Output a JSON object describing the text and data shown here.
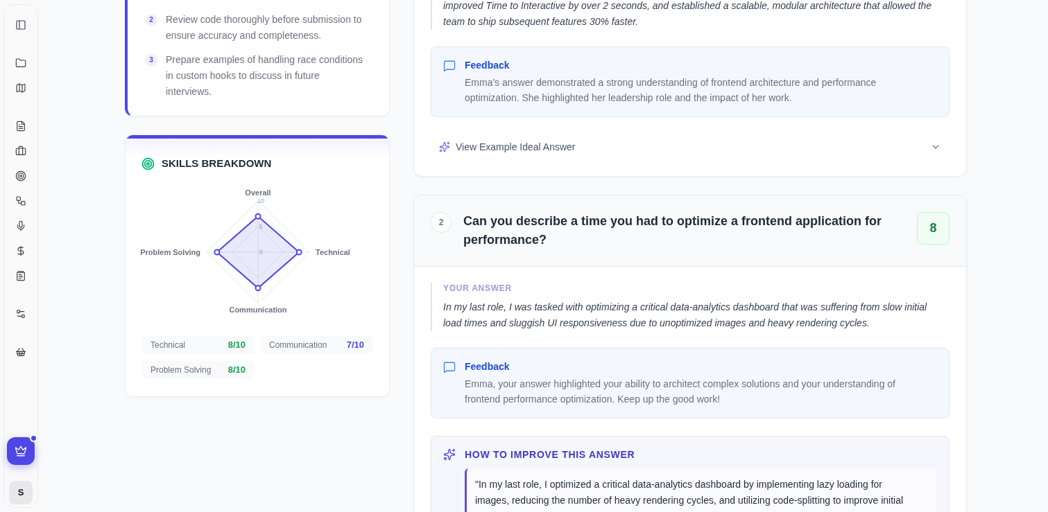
{
  "sidebar": {
    "upgrade_button": {
      "notification_dot": true
    },
    "avatar": {
      "initial": "S"
    }
  },
  "action_plan": {
    "items": [
      {
        "number": "2",
        "text": "Review code thoroughly before submission to ensure accuracy and completeness."
      },
      {
        "number": "3",
        "text": "Prepare examples of handling race conditions in custom hooks to discuss in future interviews."
      }
    ]
  },
  "skills_breakdown": {
    "title": "SKILLS BREAKDOWN",
    "chart_data": {
      "type": "radar",
      "categories": [
        "Overall",
        "Technical",
        "Communication",
        "Problem Solving"
      ],
      "series": [
        {
          "color": "#4f46e5",
          "values": [
            7,
            8,
            7,
            8
          ]
        }
      ],
      "ylim": [
        0,
        10
      ],
      "yticks": [
        0,
        5,
        10
      ]
    },
    "scores": [
      {
        "label": "Technical",
        "value": "8/10",
        "color": "#16a34a"
      },
      {
        "label": "Communication",
        "value": "7/10",
        "color": "#4f46e5"
      },
      {
        "label": "Problem Solving",
        "value": "8/10",
        "color": "#16a34a"
      }
    ]
  },
  "questions": [
    {
      "answer": "improved Time to Interactive by over 2 seconds, and established a scalable, modular architecture that allowed the team to ship subsequent features 30% faster.",
      "feedback": {
        "title": "Feedback",
        "text": "Emma's answer demonstrated a strong understanding of frontend architecture and performance optimization. She highlighted her leadership role and the impact of her work."
      },
      "ideal_answer": {
        "label": "View Example Ideal Answer",
        "expanded": false
      }
    },
    {
      "number": "2",
      "question": "Can you describe a time you had to optimize a frontend application for performance?",
      "score": "8",
      "answer_label": "YOUR ANSWER",
      "answer": "In my last role, I was tasked with optimizing a critical data-analytics dashboard that was suffering from slow initial load times and sluggish UI responsiveness due to unoptimized images and heavy rendering cycles.",
      "feedback": {
        "title": "Feedback",
        "text": "Emma, your answer highlighted your ability to architect complex solutions and your understanding of frontend performance optimization. Keep up the good work!"
      },
      "improvement": {
        "title": "HOW TO IMPROVE THIS ANSWER",
        "text": "\"In my last role, I optimized a critical data-analytics dashboard by implementing lazy loading for images, reducing the number of heavy rendering cycles, and utilizing code-splitting to improve initial"
      }
    }
  ]
}
